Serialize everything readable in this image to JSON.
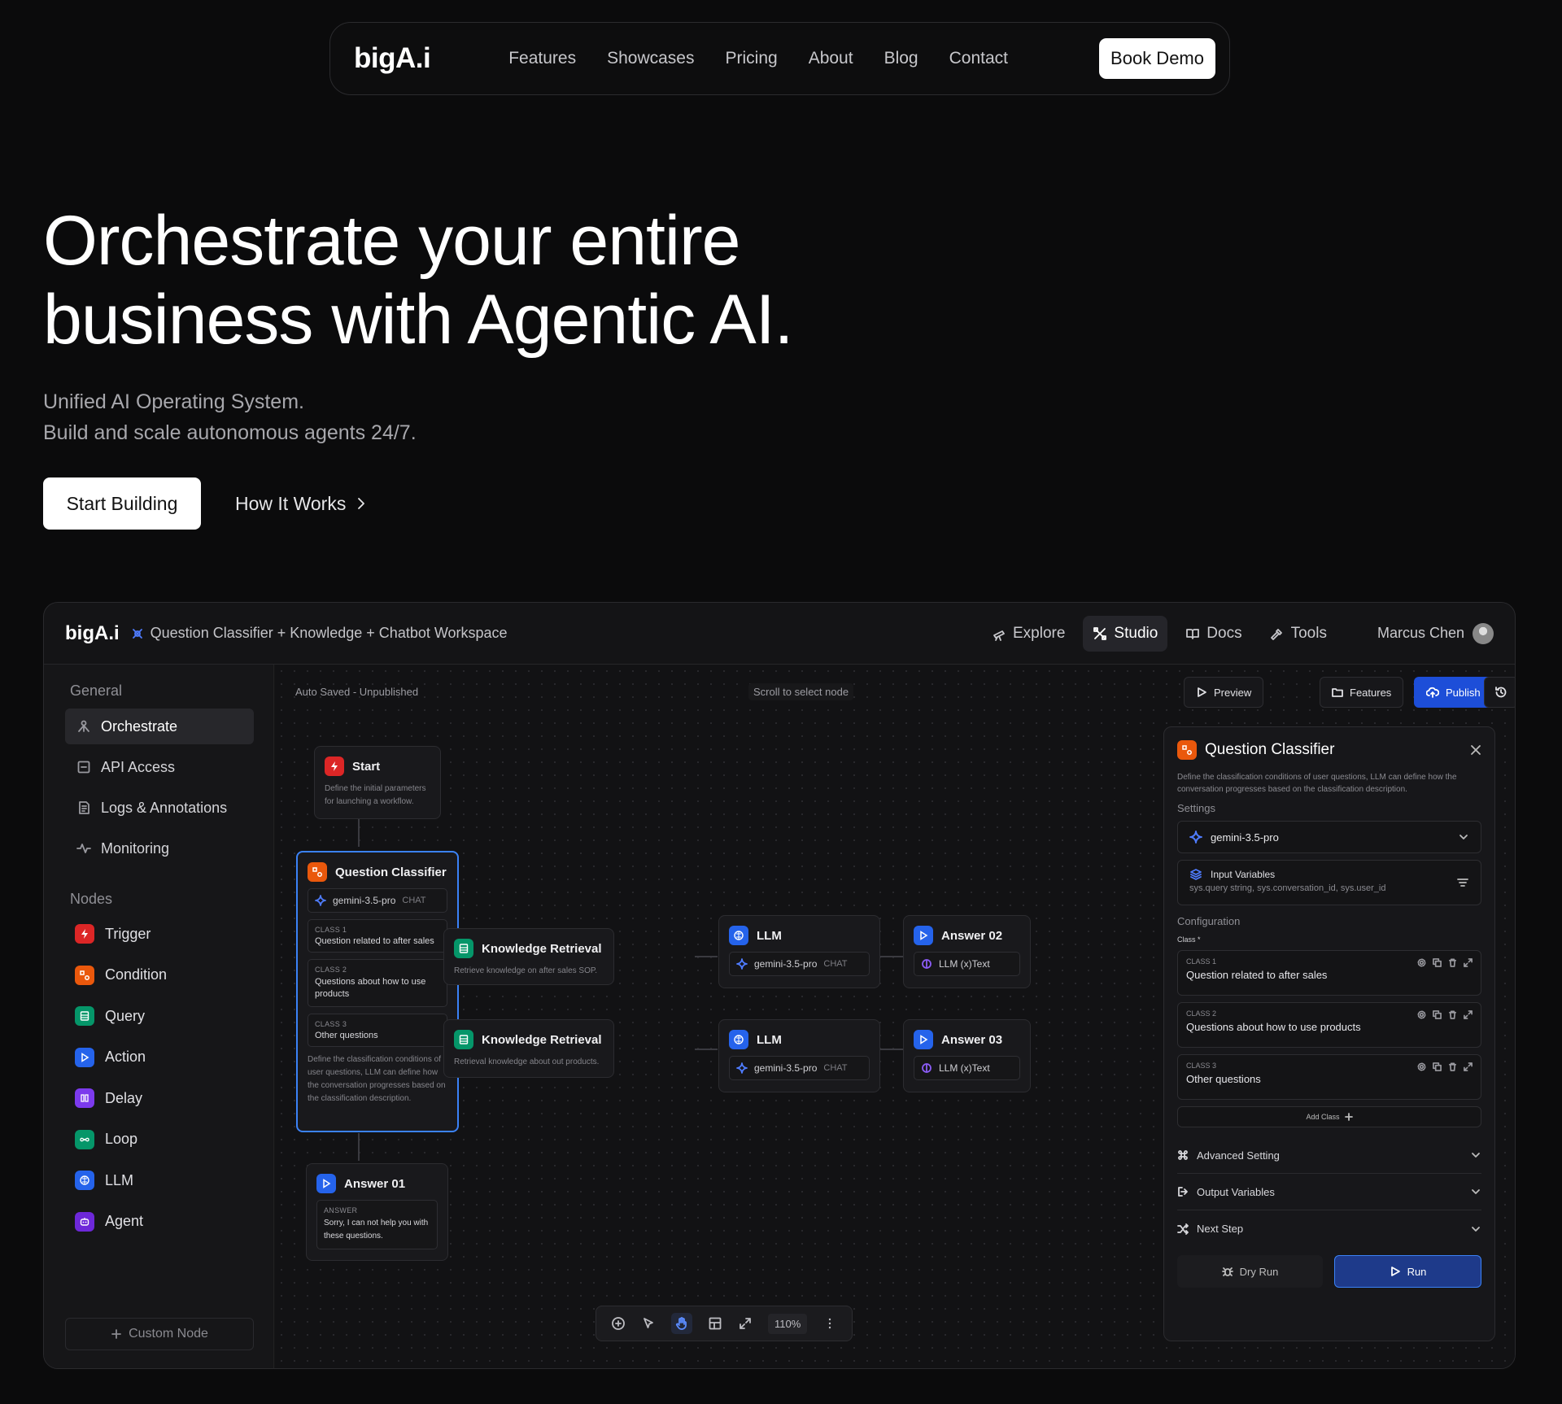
{
  "nav": {
    "logo": "bigA.i",
    "links": [
      "Features",
      "Showcases",
      "Pricing",
      "About",
      "Blog",
      "Contact"
    ],
    "cta": "Book Demo"
  },
  "hero": {
    "title": "Orchestrate your entire\nbusiness with Agentic AI.",
    "subtitle": "Unified AI Operating System.\nBuild and scale autonomous agents 24/7.",
    "primary_cta": "Start Building",
    "secondary_cta": "How It Works"
  },
  "app": {
    "logo": "bigA.i",
    "workspace": "Question Classifier + Knowledge + Chatbot Workspace",
    "header_nav": [
      "Explore",
      "Studio",
      "Docs",
      "Tools"
    ],
    "user": "Marcus Chen",
    "sidebar": {
      "general_label": "General",
      "general_items": [
        "Orchestrate",
        "API Access",
        "Logs & Annotations",
        "Monitoring"
      ],
      "nodes_label": "Nodes",
      "node_items": [
        {
          "label": "Trigger",
          "color": "#dc2626"
        },
        {
          "label": "Condition",
          "color": "#ea580c"
        },
        {
          "label": "Query",
          "color": "#059669"
        },
        {
          "label": "Action",
          "color": "#2563eb"
        },
        {
          "label": "Delay",
          "color": "#7c3aed"
        },
        {
          "label": "Loop",
          "color": "#059669"
        },
        {
          "label": "LLM",
          "color": "#2563eb"
        },
        {
          "label": "Agent",
          "color": "#6d28d9"
        }
      ],
      "custom_node": "Custom Node"
    },
    "canvas": {
      "status": "Auto Saved - Unpublished",
      "hint": "Scroll to select node",
      "toolbar": [
        "Preview",
        "Features",
        "Publish"
      ],
      "zoom": "110%"
    },
    "nodes": {
      "start": {
        "title": "Start",
        "desc": "Define the initial parameters for launching a workflow."
      },
      "qc": {
        "title": "Question Classifier",
        "model": "gemini-3.5-pro",
        "chat": "CHAT",
        "classes": [
          {
            "cap": "CLASS 1",
            "text": "Question related to after sales"
          },
          {
            "cap": "CLASS 2",
            "text": "Questions about how to use products"
          },
          {
            "cap": "CLASS 3",
            "text": "Other questions"
          }
        ],
        "desc": "Define the classification conditions of user questions, LLM can define how the conversation progresses based on the classification description."
      },
      "kr1": {
        "title": "Knowledge Retrieval",
        "desc": "Retrieve knowledge on after sales SOP."
      },
      "kr2": {
        "title": "Knowledge Retrieval",
        "desc": "Retrieval knowledge about out products."
      },
      "llm1": {
        "title": "LLM",
        "model": "gemini-3.5-pro",
        "chat": "CHAT"
      },
      "llm2": {
        "title": "LLM",
        "model": "gemini-3.5-pro",
        "chat": "CHAT"
      },
      "ans2": {
        "title": "Answer 02",
        "out": "LLM (x)Text"
      },
      "ans3": {
        "title": "Answer 03",
        "out": "LLM (x)Text"
      },
      "ans1": {
        "title": "Answer 01",
        "cap": "ANSWER",
        "text": "Sorry, I can not help you with these questions."
      }
    },
    "panel": {
      "title": "Question Classifier",
      "desc": "Define the classification conditions of user questions, LLM can define how the conversation progresses based on the classification description.",
      "settings_label": "Settings",
      "model": "gemini-3.5-pro",
      "input_vars_label": "Input Variables",
      "input_vars": "sys.query string, sys.conversation_id, sys.user_id",
      "config_label": "Configuration",
      "class_label": "Class *",
      "classes": [
        {
          "cap": "CLASS 1",
          "text": "Question related to after sales"
        },
        {
          "cap": "CLASS 2",
          "text": "Questions about how to use products"
        },
        {
          "cap": "CLASS 3",
          "text": "Other questions"
        }
      ],
      "add_class": "Add Class",
      "sections": [
        "Advanced Setting",
        "Output Variables",
        "Next Step"
      ],
      "dry_run": "Dry Run",
      "run": "Run"
    }
  }
}
